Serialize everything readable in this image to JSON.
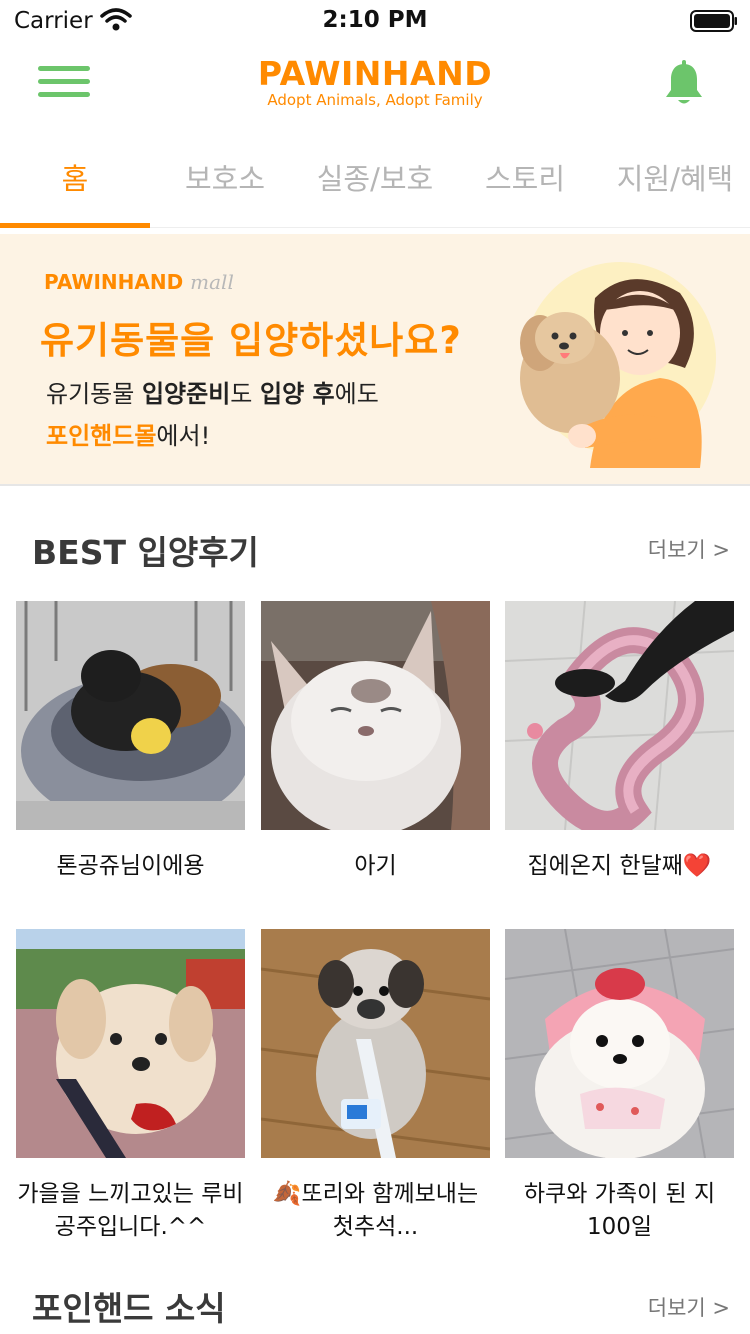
{
  "status": {
    "carrier": "Carrier",
    "time": "2:10 PM"
  },
  "header": {
    "brand": "PAWINHAND",
    "tagline": "Adopt Animals, Adopt Family"
  },
  "tabs": [
    {
      "label": "홈"
    },
    {
      "label": "보호소"
    },
    {
      "label": "실종/보호"
    },
    {
      "label": "스토리"
    },
    {
      "label": "지원/혜택"
    }
  ],
  "banner": {
    "brand": "PAWINHAND",
    "brand_suffix": "mall",
    "headline": "유기동물을 입양하셨나요?",
    "line1_a": "유기동물 ",
    "line1_b": "입양준비",
    "line1_c": "도 ",
    "line1_d": "입양 후",
    "line1_e": "에도",
    "line2_a": "포인핸드몰",
    "line2_b": "에서!"
  },
  "best": {
    "title": "BEST 입양후기",
    "more": "더보기 >",
    "items": [
      {
        "caption": "톤공쥬님이에용"
      },
      {
        "caption": "아기"
      },
      {
        "caption": "집에온지 한달째❤️"
      },
      {
        "caption": "가을을 느끼고있는 루비공주입니다.^^"
      },
      {
        "caption": "🍂또리와 함께보내는 첫추석..."
      },
      {
        "caption": "하쿠와 가족이 된 지 100일"
      }
    ]
  },
  "news": {
    "title": "포인핸드 소식",
    "more": "더보기 >"
  },
  "colors": {
    "accent": "#ff8a00",
    "green": "#6cc56b",
    "banner_bg": "#fdf3e4"
  }
}
